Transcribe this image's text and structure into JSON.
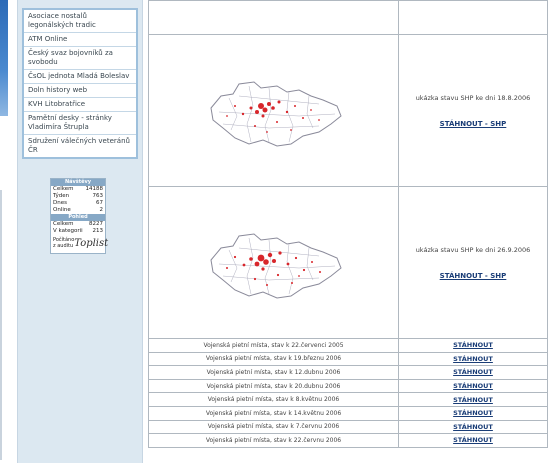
{
  "sidebar": {
    "links": [
      {
        "label": "Asociace nostalů legonálských tradic"
      },
      {
        "label": "ATM Online"
      },
      {
        "label": "Český svaz bojovníků za svobodu"
      },
      {
        "label": "ČsOL jednota Mladá Boleslav"
      },
      {
        "label": "Doln history web"
      },
      {
        "label": "KVH Litobratřice"
      },
      {
        "label": "Pamětní desky - stránky Vladimíra Štrupla"
      },
      {
        "label": "Sdružení válečných veteránů ČR"
      }
    ],
    "stats": {
      "head1": "Návštěvy",
      "rows1": [
        {
          "label": "Celkem",
          "value": "14188"
        },
        {
          "label": "Týden",
          "value": "763"
        },
        {
          "label": "Dnes",
          "value": "67"
        },
        {
          "label": "Online",
          "value": "2"
        }
      ],
      "head2": "Pohled",
      "rows2": [
        {
          "label": "Celkem",
          "value": "8227"
        },
        {
          "label": "V kategorii",
          "value": "213"
        }
      ],
      "footer_text": "Počítáno z auditu",
      "footer_logo": "Toplist"
    }
  },
  "main": {
    "maps": [
      {
        "caption": "ukázka stavu SHP ke dni 18.8.2006",
        "link": "STÁHNOUT - SHP"
      },
      {
        "caption": "ukázka stavu SHP ke dni 26.9.2006",
        "link": "STÁHNOUT - SHP"
      }
    ],
    "downloads": [
      {
        "label": "Vojenská pietní místa, stav k 22.červenci 2005",
        "link": "STÁHNOUT"
      },
      {
        "label": "Vojenská pietní místa, stav k 19.březnu 2006",
        "link": "STÁHNOUT"
      },
      {
        "label": "Vojenská pietní místa, stav k 12.dubnu 2006",
        "link": "STÁHNOUT"
      },
      {
        "label": "Vojenská pietní místa, stav k 20.dubnu 2006",
        "link": "STÁHNOUT"
      },
      {
        "label": "Vojenská pietní místa, stav k 8.květnu 2006",
        "link": "STÁHNOUT"
      },
      {
        "label": "Vojenská pietní místa, stav k 14.květnu 2006",
        "link": "STÁHNOUT"
      },
      {
        "label": "Vojenská pietní místa, stav k 7.červnu 2006",
        "link": "STÁHNOUT"
      },
      {
        "label": "Vojenská pietní místa, stav k 22.červnu 2006",
        "link": "STÁHNOUT"
      }
    ]
  },
  "colors": {
    "sidebar_bg": "#dce8f1",
    "link_color": "#1a3d77",
    "map_point": "#d8262b",
    "map_border": "#8a8a9a"
  }
}
